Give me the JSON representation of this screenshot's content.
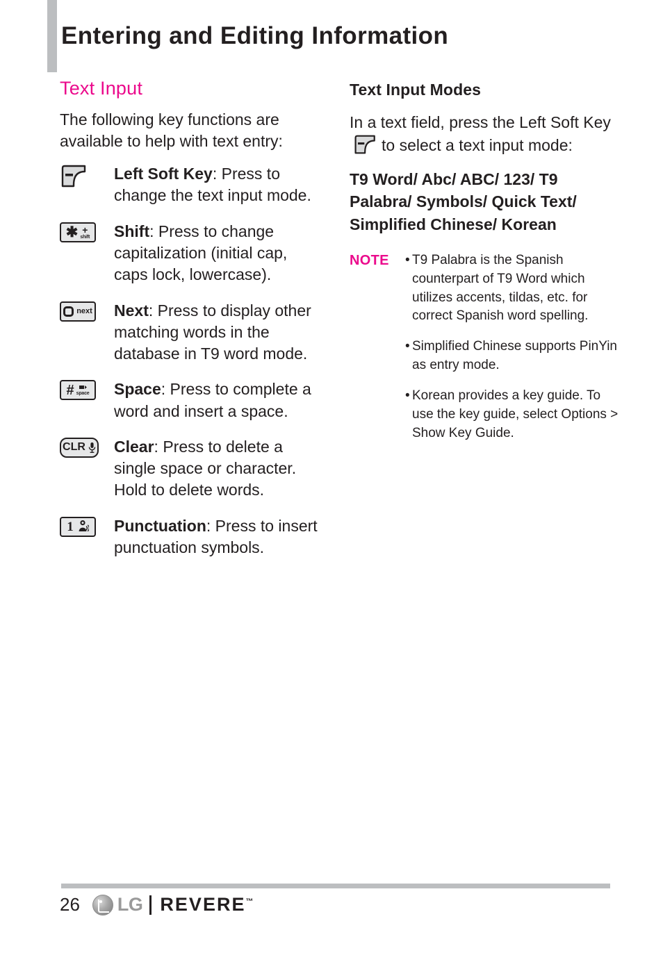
{
  "header": {
    "title": "Entering and Editing Information"
  },
  "left_column": {
    "section_title": "Text Input",
    "intro": "The following key functions are available to help with text entry:",
    "keys": [
      {
        "icon": "left-soft-key-icon",
        "name": "Left Soft Key",
        "description": ": Press to change the text input mode."
      },
      {
        "icon": "shift-key-icon",
        "glyph_main": "✱",
        "glyph_top": "+",
        "glyph_sub": "shift",
        "name": "Shift",
        "description": ": Press to change capitalization (initial cap, caps lock, lowercase)."
      },
      {
        "icon": "next-key-icon",
        "glyph_sub": "next",
        "name": "Next",
        "description": ": Press to display other matching words in the database in T9 word mode."
      },
      {
        "icon": "space-key-icon",
        "glyph_main": "#",
        "glyph_sub": "space",
        "name": "Space",
        "description": ": Press to complete a word and insert a space."
      },
      {
        "icon": "clear-key-icon",
        "glyph_main": "CLR",
        "name": "Clear",
        "description": ": Press to delete a single space or character. Hold to delete words."
      },
      {
        "icon": "punctuation-key-icon",
        "glyph_main": "1",
        "name": "Punctuation",
        "description": ": Press to insert punctuation symbols."
      }
    ]
  },
  "right_column": {
    "section_title": "Text Input Modes",
    "intro_part1": "In a text field, press the Left Soft Key",
    "intro_part2": "to select a text input mode:",
    "modes": "T9 Word/ Abc/ ABC/ 123/ T9 Palabra/ Symbols/ Quick Text/ Simplified Chinese/ Korean",
    "note": {
      "label": "NOTE",
      "bullet": "•",
      "items": [
        "T9 Palabra is the Spanish counterpart of T9 Word which utilizes accents, tildas, etc. for correct Spanish word spelling.",
        "Simplified Chinese supports PinYin as entry mode.",
        "Korean provides a key guide. To use the key guide, select Options > Show Key Guide."
      ]
    }
  },
  "footer": {
    "page_number": "26",
    "lg_wordmark": "LG",
    "product_wordmark": "REVERE",
    "trademark": "™"
  },
  "colors": {
    "accent_pink": "#eb0a8c",
    "text_dark": "#231f20",
    "rule_gray": "#bcbec0",
    "key_fill": "#e6e7e8"
  }
}
